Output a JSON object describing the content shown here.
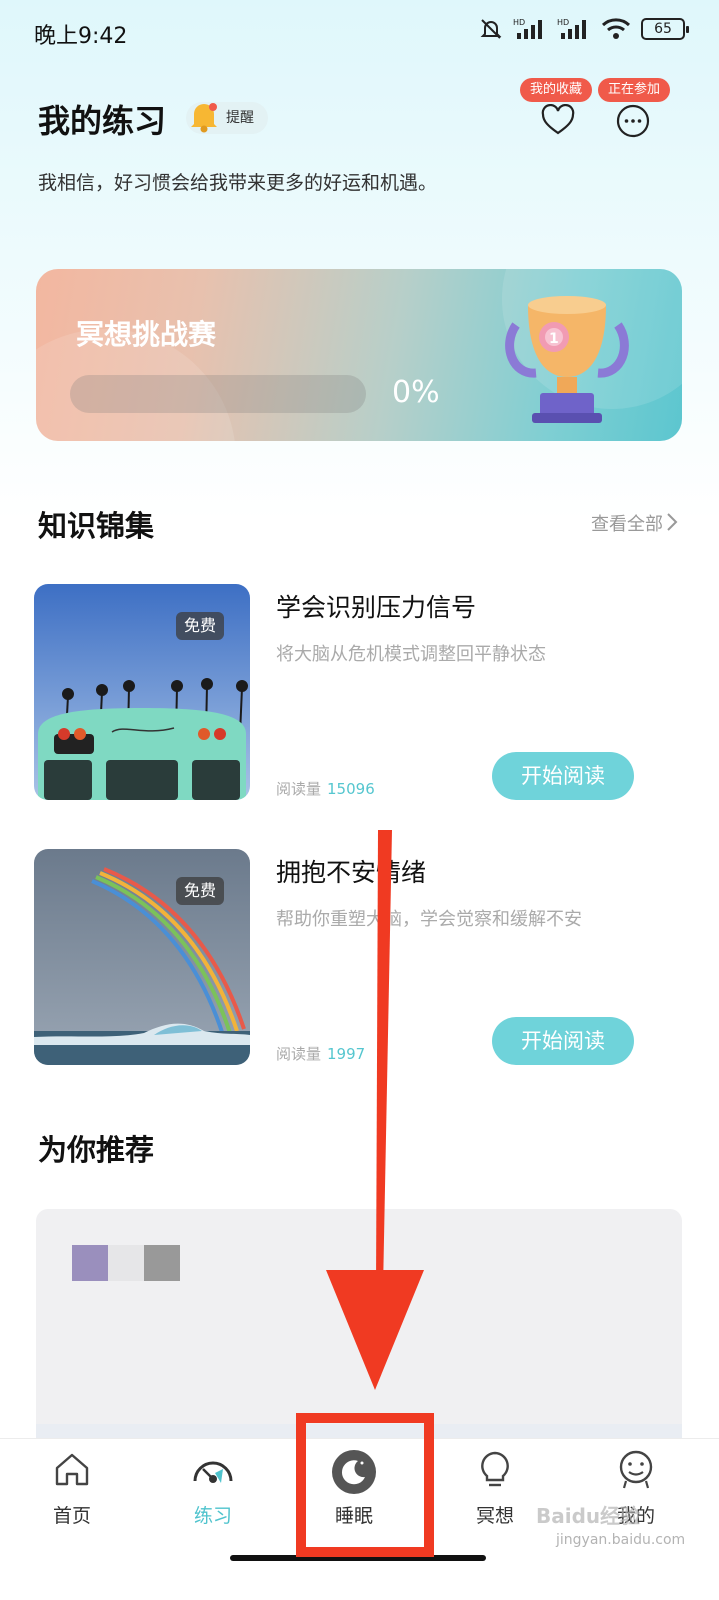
{
  "status_bar": {
    "time": "晚上9:42",
    "battery": "65"
  },
  "header": {
    "title": "我的练习",
    "remind_label": "提醒",
    "subtitle": "我相信，好习惯会给我带来更多的好运和机遇。",
    "favorites_badge": "我的收藏",
    "joining_badge": "正在参加"
  },
  "challenge": {
    "title": "冥想挑战赛",
    "progress_text": "0%",
    "progress": 0
  },
  "knowledge": {
    "title": "知识锦集",
    "see_all": "查看全部",
    "articles": [
      {
        "tag": "免费",
        "title": "学会识别压力信号",
        "desc": "将大脑从危机模式调整回平静状态",
        "reads_label": "阅读量",
        "reads": "15096",
        "button": "开始阅读"
      },
      {
        "tag": "免费",
        "title": "拥抱不安情绪",
        "desc": "帮助你重塑大脑，学会觉察和缓解不安",
        "reads_label": "阅读量",
        "reads": "1997",
        "button": "开始阅读"
      }
    ]
  },
  "recommend": {
    "title": "为你推荐"
  },
  "bottom_nav": [
    {
      "label": "首页",
      "icon": "home-icon",
      "active": false
    },
    {
      "label": "练习",
      "icon": "practice-gauge-icon",
      "active": true
    },
    {
      "label": "睡眠",
      "icon": "moon-icon",
      "active": false
    },
    {
      "label": "冥想",
      "icon": "lightbulb-icon",
      "active": false
    },
    {
      "label": "我的",
      "icon": "smiley-icon",
      "active": false
    }
  ],
  "colors": {
    "accent": "#4fc3cd",
    "button": "#6fd3da",
    "badge": "#f05a4a",
    "annotation": "#f03a22"
  },
  "watermark": {
    "text": "Baidu经验",
    "sub": "jingyan.baidu.com"
  }
}
